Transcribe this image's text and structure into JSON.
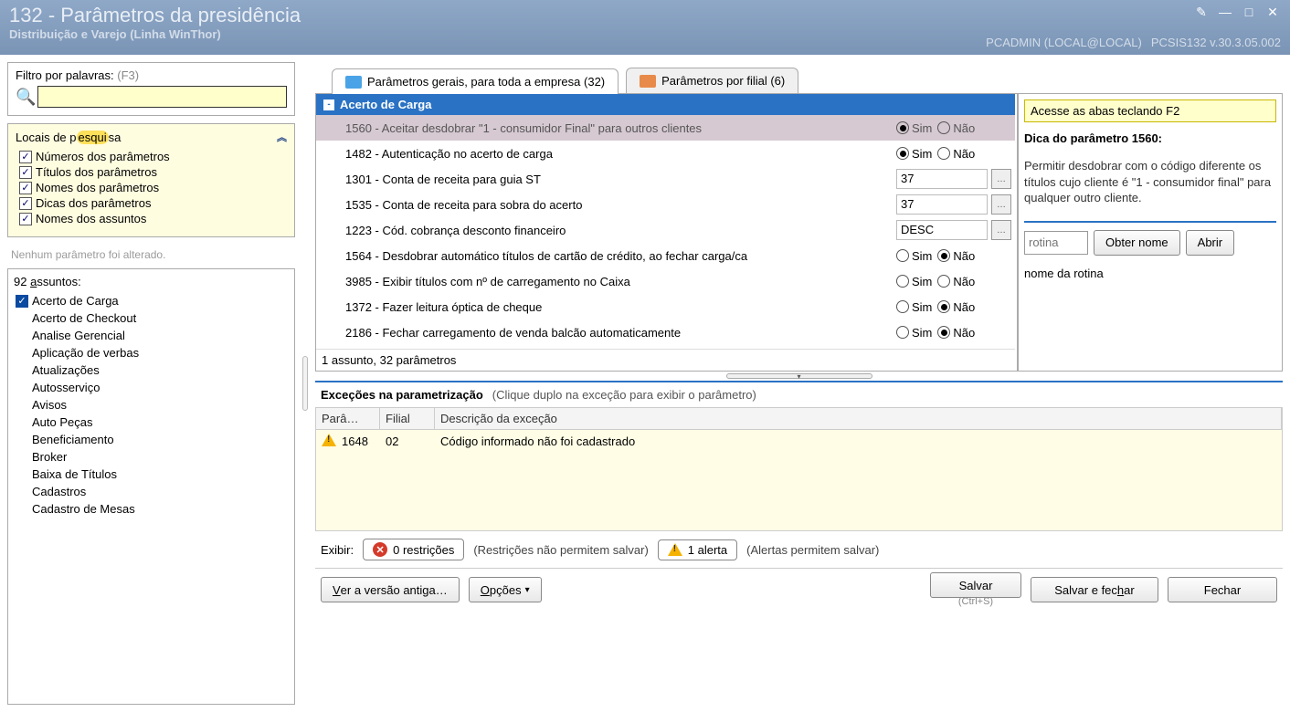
{
  "titlebar": {
    "title": "132 - Parâmetros da presidência",
    "subtitle": "Distribuição e Varejo (Linha WinThor)",
    "user": "PCADMIN (LOCAL@LOCAL)",
    "version": "PCSIS132  v.30.3.05.002"
  },
  "filter": {
    "label": "Filtro por palavras:",
    "hint": "(F3)",
    "value": ""
  },
  "locais": {
    "header": "Locais de pesquisa",
    "items": [
      "Números dos parâmetros",
      "Títulos dos parâmetros",
      "Nomes dos parâmetros",
      "Dicas dos parâmetros",
      "Nomes dos assuntos"
    ],
    "status": "Nenhum parâmetro foi alterado."
  },
  "subjects": {
    "header": "92 assuntos:",
    "items": [
      "Acerto de Carga",
      "Acerto de Checkout",
      "Analise Gerencial",
      "Aplicação de verbas",
      "Atualizações",
      "Autosserviço",
      "Avisos",
      "Auto Peças",
      "Beneficiamento",
      "Broker",
      "Baixa de Títulos",
      "Cadastros",
      "Cadastro de Mesas"
    ]
  },
  "tabs": {
    "general": "Parâmetros gerais, para toda a empresa  (32)",
    "branch": "Parâmetros por filial  (6)"
  },
  "group": {
    "title": "Acerto de Carga"
  },
  "params": [
    {
      "id": "1560",
      "label": "1560 - Aceitar desdobrar \"1 - consumidor Final\" para outros clientes",
      "type": "radio",
      "value": "Sim"
    },
    {
      "id": "1482",
      "label": "1482 - Autenticação no acerto de carga",
      "type": "radio",
      "value": "Sim"
    },
    {
      "id": "1301",
      "label": "1301 - Conta de receita para guia ST",
      "type": "lookup",
      "value": "37"
    },
    {
      "id": "1535",
      "label": "1535 - Conta de receita para sobra do acerto",
      "type": "lookup",
      "value": "37"
    },
    {
      "id": "1223",
      "label": "1223 - Cód. cobrança desconto financeiro",
      "type": "lookup",
      "value": "DESC"
    },
    {
      "id": "1564",
      "label": "1564 - Desdobrar automático títulos de cartão de crédito, ao fechar carga/ca",
      "type": "radio",
      "value": "Não"
    },
    {
      "id": "3985",
      "label": "3985 - Exibir títulos com nº de carregamento no Caixa",
      "type": "radio",
      "value": ""
    },
    {
      "id": "1372",
      "label": "1372 - Fazer leitura óptica de cheque",
      "type": "radio",
      "value": "Não"
    },
    {
      "id": "2186",
      "label": "2186 - Fechar carregamento de venda balcão automaticamente",
      "type": "radio",
      "value": "Não"
    }
  ],
  "radio_labels": {
    "yes": "Sim",
    "no": "Não"
  },
  "params_footer": "1 assunto, 32 parâmetros",
  "info": {
    "banner": "Acesse as abas teclando F2",
    "title": "Dica do parâmetro 1560:",
    "text": "Permitir desdobrar com o código diferente os títulos cujo cliente é \"1 - consumidor final\" para qualquer outro cliente.",
    "rotina_placeholder": "rotina",
    "btn_nome": "Obter nome",
    "btn_abrir": "Abrir",
    "rotina_name": "nome da rotina"
  },
  "exceptions": {
    "title": "Exceções na parametrização",
    "subtitle": "(Clique duplo na exceção para exibir o parâmetro)",
    "cols": {
      "param": "Parâ…",
      "filial": "Filial",
      "desc": "Descrição da exceção"
    },
    "rows": [
      {
        "param": "1648",
        "filial": "02",
        "desc": "Código informado não foi cadastrado"
      }
    ]
  },
  "filterbar": {
    "label": "Exibir:",
    "restr_btn": "0 restrições",
    "restr_note": "(Restrições não permitem salvar)",
    "alert_btn": "1 alerta",
    "alert_note": "(Alertas permitem salvar)"
  },
  "bottom": {
    "ver_antiga": "Ver a versão antiga…",
    "opcoes": "Opções",
    "salvar": "Salvar",
    "salvar_hint": "(Ctrl+S)",
    "salvar_fechar": "Salvar e fechar",
    "fechar": "Fechar"
  }
}
